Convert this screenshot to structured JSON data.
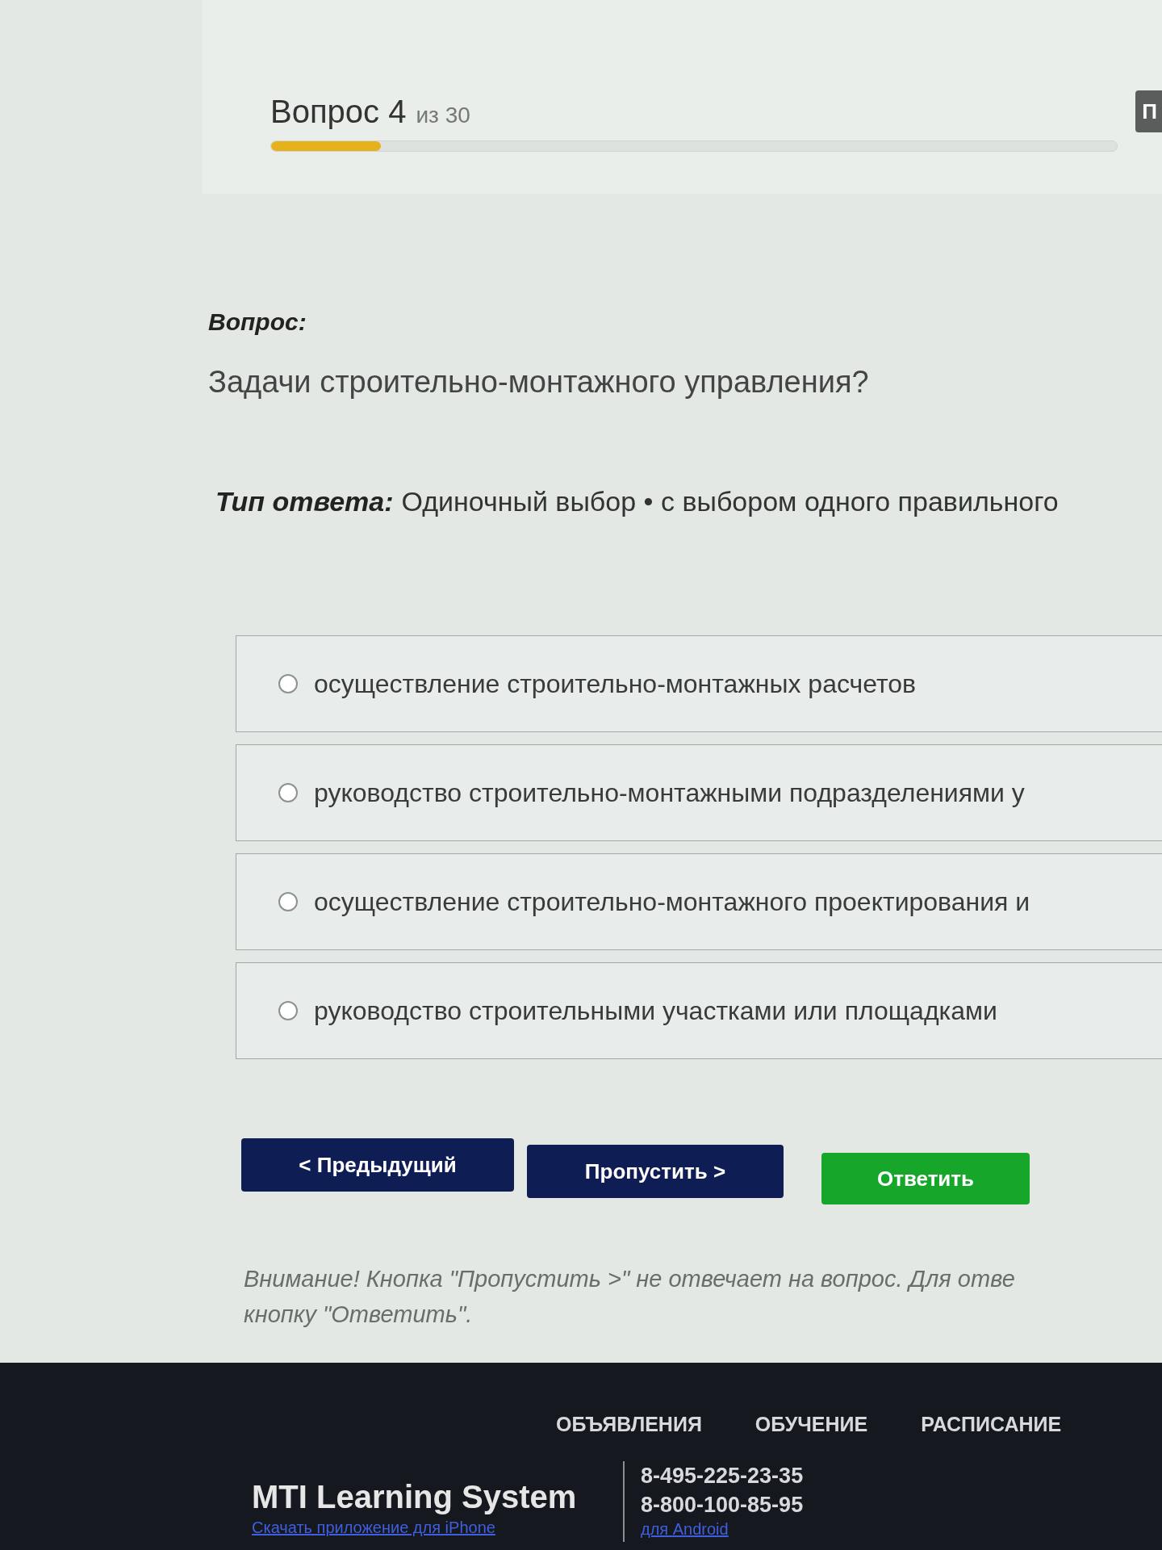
{
  "header": {
    "title": "Вопрос 4",
    "counter": "из 30",
    "progress": {
      "level": 0.13
    },
    "side_button": {
      "label": "П"
    }
  },
  "question": {
    "label": "Вопрос:",
    "text": "Задачи строительно-монтажного управления?"
  },
  "answer_type": {
    "label": "Тип ответа:",
    "value": "Одиночный выбор • с выбором одного правильного"
  },
  "options": [
    {
      "text": "осуществление строительно-монтажных расчетов",
      "selected": false
    },
    {
      "text": "руководство строительно-монтажными подразделениями у",
      "selected": false
    },
    {
      "text": "осуществление строительно-монтажного проектирования и",
      "selected": false
    },
    {
      "text": "руководство строительными участками или площадками",
      "selected": false
    }
  ],
  "buttons": [
    {
      "label": "< Предыдущий",
      "kind": "nav"
    },
    {
      "label": "Пропустить >",
      "kind": "nav"
    },
    {
      "label": "Ответить",
      "kind": "submit"
    }
  ],
  "notice": {
    "lines": [
      "Внимание! Кнопка \"Пропустить >\" не отвечает на вопрос. Для отве",
      "кнопку \"Ответить\"."
    ]
  },
  "footer": {
    "nav": [
      "ОБЪЯВЛЕНИЯ",
      "ОБУЧЕНИЕ",
      "РАСПИСАНИЕ"
    ],
    "brand": "MTI Learning System",
    "app_link": "Скачать приложение для iPhone",
    "phones": [
      "8-495-225-23-35",
      "8-800-100-85-95"
    ],
    "android_link": "для Android"
  }
}
